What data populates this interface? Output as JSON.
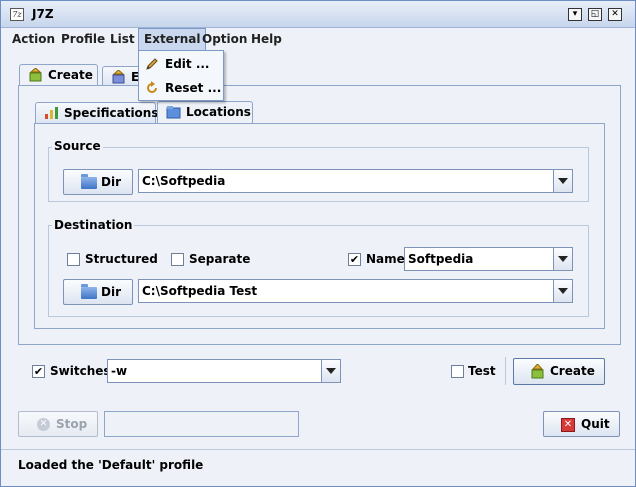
{
  "window": {
    "title": "J7Z",
    "app_icon": "7z"
  },
  "menubar": {
    "items": [
      "Action",
      "Profile",
      "List",
      "External",
      "Option",
      "Help"
    ],
    "open_menu": "External"
  },
  "external_menu": {
    "items": [
      "Edit ...",
      "Reset ..."
    ]
  },
  "main_tabs": {
    "create": "Create",
    "extract_partial": "E"
  },
  "sub_tabs": {
    "specifications": "Specifications",
    "locations": "Locations"
  },
  "source": {
    "title": "Source",
    "dir_button": "Dir",
    "path": "C:\\Softpedia"
  },
  "destination": {
    "title": "Destination",
    "structured_label": "Structured",
    "structured_checked": false,
    "separate_label": "Separate",
    "separate_checked": false,
    "name_label": "Name",
    "name_checked": true,
    "name_value": "Softpedia",
    "dir_button": "Dir",
    "path": "C:\\Softpedia Test"
  },
  "switches": {
    "label": "Switches",
    "checked": true,
    "value": "-w"
  },
  "test": {
    "label": "Test",
    "checked": false
  },
  "create_button": "Create",
  "stop_button": "Stop",
  "quit_button": "Quit",
  "status": "Loaded the 'Default' profile",
  "check_mark": "✔",
  "colors": {
    "accent": "#c9d8ee",
    "border": "#8ea6cc",
    "quit_icon": "#d83a3a"
  }
}
